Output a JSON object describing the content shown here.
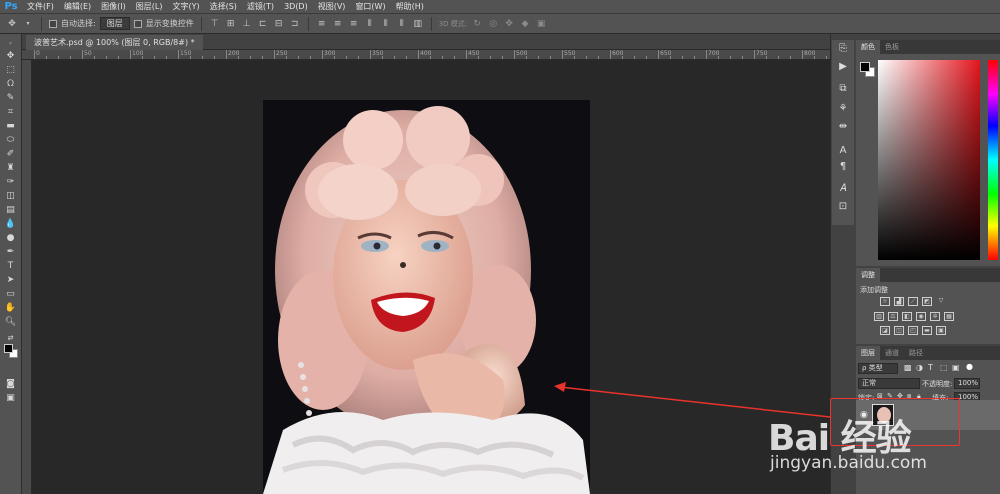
{
  "app": {
    "logo": "Ps",
    "accent": "#31a8ff"
  },
  "menu": [
    "文件(F)",
    "编辑(E)",
    "图像(I)",
    "图层(L)",
    "文字(Y)",
    "选择(S)",
    "滤镜(T)",
    "3D(D)",
    "视图(V)",
    "窗口(W)",
    "帮助(H)"
  ],
  "options": {
    "auto_select_label": "自动选择:",
    "auto_select_value": "图层",
    "show_transform_label": "显示变换控件",
    "mode_3d_label": "3D 模式:"
  },
  "document": {
    "tab_title": "波普艺术.psd @ 100% (图层 0, RGB/8#) *"
  },
  "ruler": {
    "top_labels": [
      "0",
      "50",
      "100",
      "150",
      "200",
      "250",
      "300",
      "350",
      "400",
      "450",
      "500",
      "550",
      "600",
      "650",
      "700",
      "750",
      "800"
    ]
  },
  "panels": {
    "color": {
      "tabs": [
        "颜色",
        "色板"
      ],
      "foreground": "#000000",
      "background": "#ffffff"
    },
    "adjustments": {
      "tab": "调整",
      "add_label": "添加调整"
    },
    "layers": {
      "tabs": [
        "图层",
        "通道",
        "路径"
      ],
      "filter_label": "ρ 类型",
      "blend_mode": "正常",
      "opacity_label": "不透明度:",
      "opacity_value": "100%",
      "lock_label": "锁定:",
      "fill_label": "填充:",
      "fill_value": "100%"
    }
  },
  "watermark": {
    "logo_text": "Bai 经验",
    "url": "jingyan.baidu.com"
  },
  "annotation": {
    "color": "#e8332c"
  }
}
